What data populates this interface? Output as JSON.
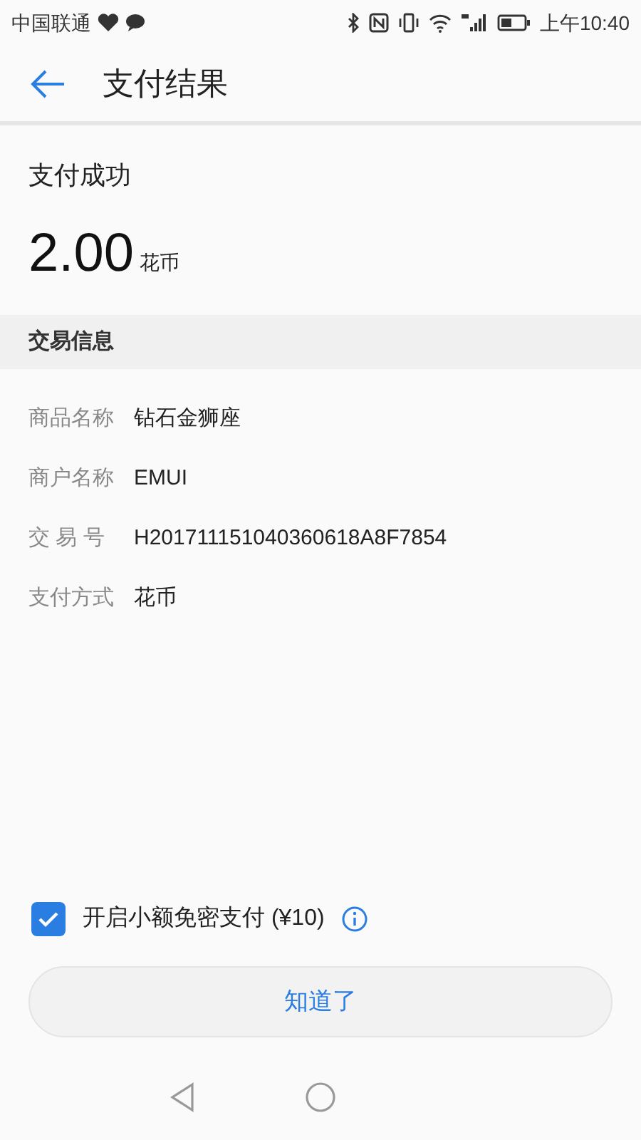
{
  "status_bar": {
    "carrier": "中国联通",
    "time": "上午10:40"
  },
  "header": {
    "title": "支付结果"
  },
  "result": {
    "status": "支付成功",
    "amount": "2.00",
    "unit": "花币"
  },
  "section": {
    "title": "交易信息"
  },
  "details": [
    {
      "label": "商品名称",
      "value": "钻石金狮座"
    },
    {
      "label": "商户名称",
      "value": "EMUI"
    },
    {
      "label": "交 易 号",
      "value": "H201711151040360618A8F7854"
    },
    {
      "label": "支付方式",
      "value": "花币"
    }
  ],
  "option": {
    "label": "开启小额免密支付 (¥10)",
    "checked": true
  },
  "button": {
    "label": "知道了"
  }
}
